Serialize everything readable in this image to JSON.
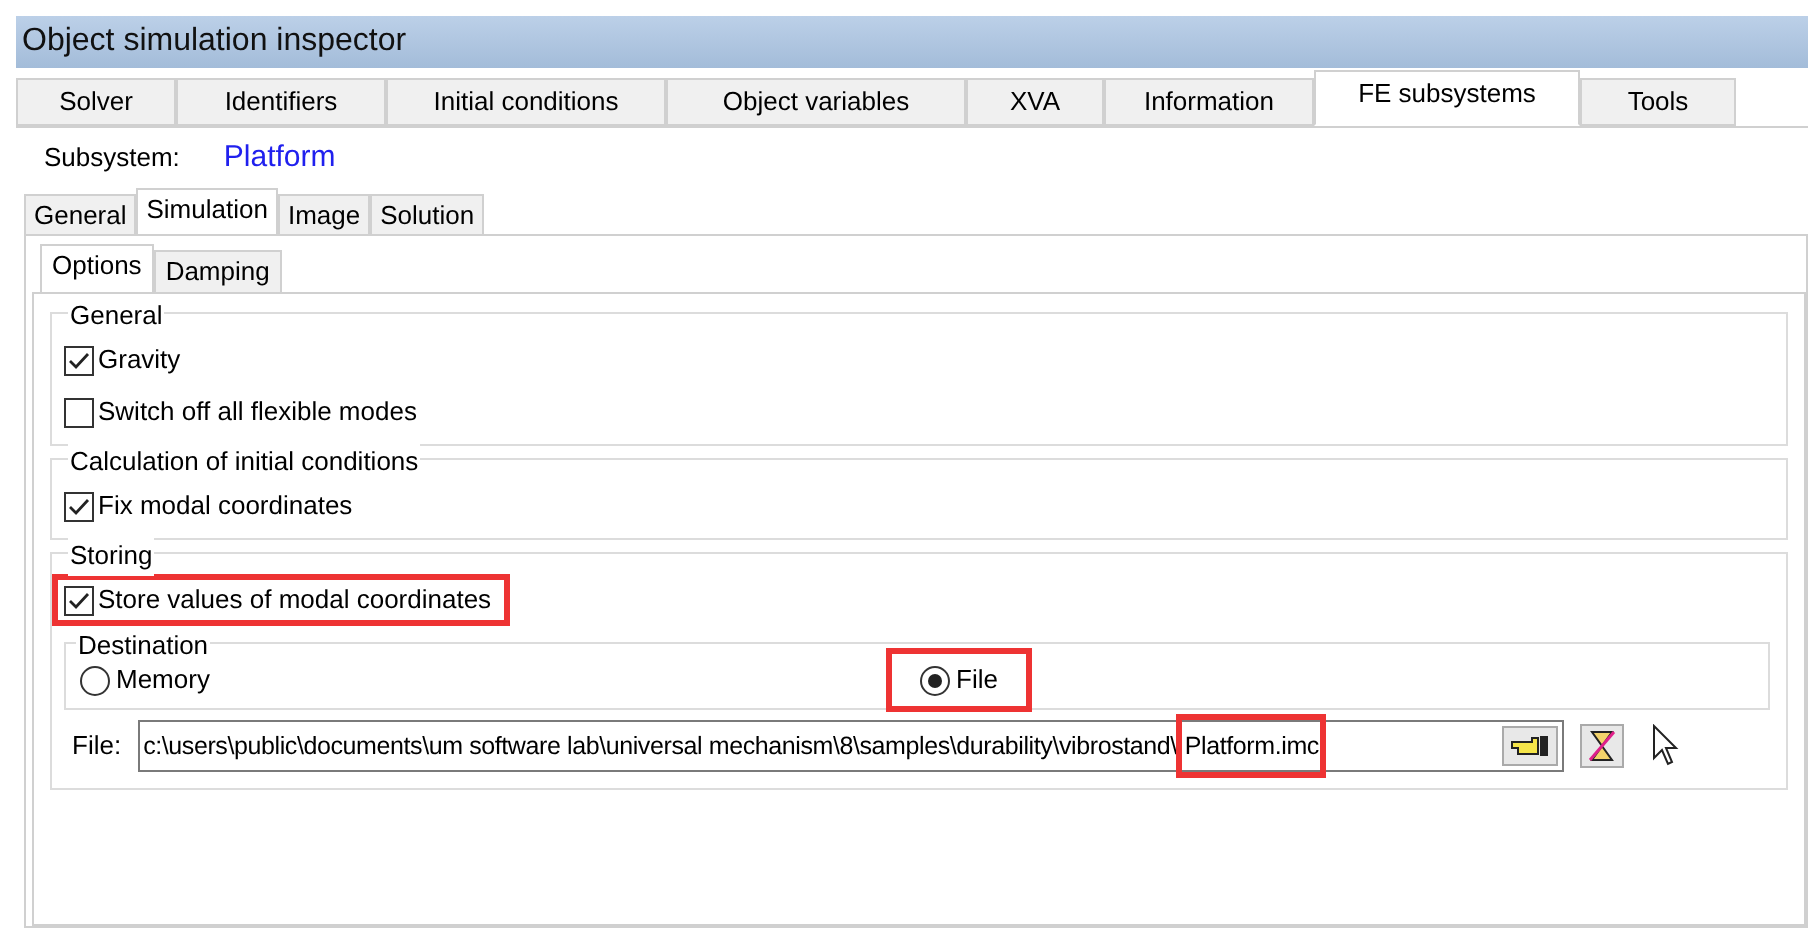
{
  "window": {
    "title": "Object simulation inspector"
  },
  "tabs": [
    {
      "label": "Solver",
      "selected": false
    },
    {
      "label": "Identifiers",
      "selected": false
    },
    {
      "label": "Initial conditions",
      "selected": false
    },
    {
      "label": "Object variables",
      "selected": false
    },
    {
      "label": "XVA",
      "selected": false
    },
    {
      "label": "Information",
      "selected": false
    },
    {
      "label": "FE subsystems",
      "selected": true
    },
    {
      "label": "Tools",
      "selected": false
    }
  ],
  "subsystem": {
    "label": "Subsystem:",
    "value": "Platform"
  },
  "subtabs": [
    {
      "label": "General",
      "selected": false
    },
    {
      "label": "Simulation",
      "selected": true
    },
    {
      "label": "Image",
      "selected": false
    },
    {
      "label": "Solution",
      "selected": false
    }
  ],
  "option_tabs": [
    {
      "label": "Options",
      "selected": true
    },
    {
      "label": "Damping",
      "selected": false
    }
  ],
  "groups": [
    {
      "title": "General",
      "options": [
        {
          "label": "Gravity",
          "checked": true,
          "highlighted": false
        },
        {
          "label": "Switch off all flexible modes",
          "checked": false,
          "highlighted": false
        }
      ]
    },
    {
      "title": "Calculation of initial conditions",
      "options": [
        {
          "label": "Fix modal coordinates",
          "checked": true,
          "highlighted": false
        }
      ]
    },
    {
      "title": "Storing",
      "options": [
        {
          "label": "Store values of modal coordinates",
          "checked": true,
          "highlighted": true
        }
      ],
      "destination": {
        "title": "Destination",
        "choices": [
          {
            "label": "Memory",
            "selected": false,
            "highlighted": false
          },
          {
            "label": "File",
            "selected": true,
            "highlighted": true
          }
        ]
      },
      "file": {
        "label": "File:",
        "path": "c:\\users\\public\\documents\\um software lab\\universal mechanism\\8\\samples\\durability\\vibrostand\\",
        "name": "Platform.imc"
      }
    }
  ]
}
